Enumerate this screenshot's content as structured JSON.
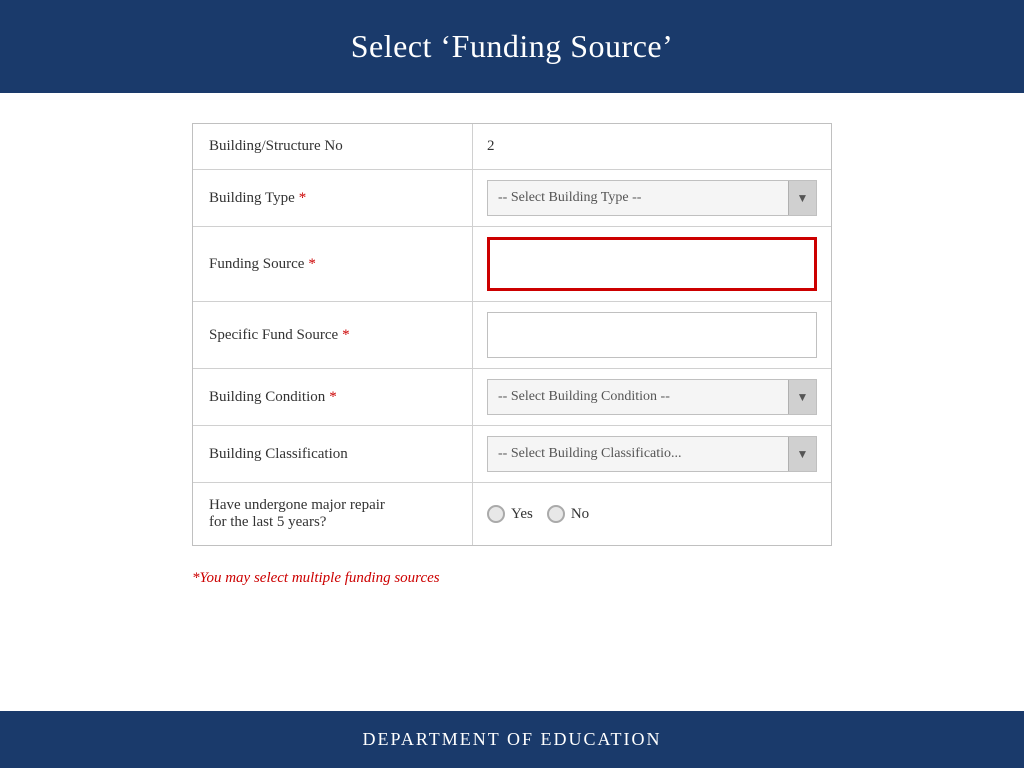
{
  "header": {
    "title": "Select ‘Funding Source’"
  },
  "form": {
    "rows": [
      {
        "id": "building-structure-no",
        "label": "Building/Structure No",
        "required": false,
        "field_type": "text_value",
        "value": "2"
      },
      {
        "id": "building-type",
        "label": "Building Type",
        "required": true,
        "field_type": "select",
        "placeholder": "-- Select Building Type --"
      },
      {
        "id": "funding-source",
        "label": "Funding Source",
        "required": true,
        "field_type": "text_input_highlighted",
        "value": ""
      },
      {
        "id": "specific-fund-source",
        "label": "Specific Fund Source",
        "required": true,
        "field_type": "text_input_plain",
        "value": ""
      },
      {
        "id": "building-condition",
        "label": "Building Condition",
        "required": true,
        "field_type": "select",
        "placeholder": "-- Select Building Condition --"
      },
      {
        "id": "building-classification",
        "label": "Building Classification",
        "required": false,
        "field_type": "select",
        "placeholder": "-- Select Building Classificatio..."
      },
      {
        "id": "major-repair",
        "label": "Have undergone major repair for the last 5 years?",
        "required": false,
        "field_type": "radio",
        "options": [
          "Yes",
          "No"
        ]
      }
    ]
  },
  "note": {
    "text": "*You may select multiple funding sources"
  },
  "footer": {
    "text": "Department of Education"
  },
  "icons": {
    "dropdown_arrow": "▼",
    "radio_empty": ""
  }
}
